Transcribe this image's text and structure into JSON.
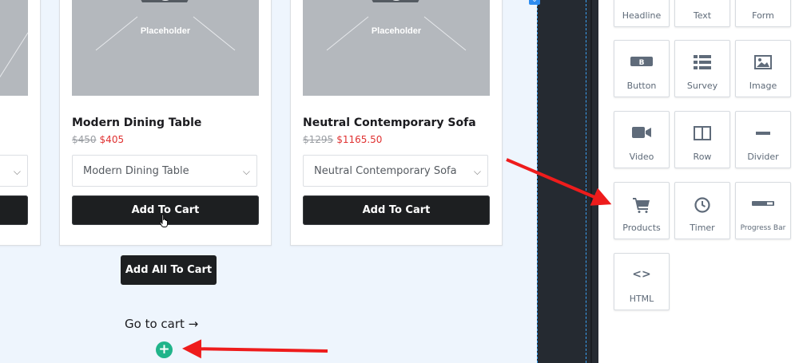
{
  "canvas": {
    "products": [
      {
        "placeholder": "",
        "title": "",
        "price_old": "",
        "price_new": "",
        "select_value": "",
        "button_label": ""
      },
      {
        "placeholder": "Placeholder",
        "title": "Modern Dining Table",
        "price_old": "$450",
        "price_new": "$405",
        "select_value": "Modern Dining Table",
        "button_label": "Add To Cart"
      },
      {
        "placeholder": "Placeholder",
        "title": "Neutral Contemporary Sofa",
        "price_old": "$1295",
        "price_new": "$1165.50",
        "select_value": "Neutral Contemporary Sofa",
        "button_label": "Add To Cart"
      }
    ],
    "add_all_label": "Add All To Cart",
    "go_to_cart_label": "Go to cart →",
    "add_block_symbol": "+"
  },
  "elements_panel": {
    "tiles": [
      {
        "label": "Headline",
        "icon": "headline-icon"
      },
      {
        "label": "Text",
        "icon": "text-icon"
      },
      {
        "label": "Form",
        "icon": "form-icon"
      },
      {
        "label": "Button",
        "icon": "button-icon",
        "glyph": "B"
      },
      {
        "label": "Survey",
        "icon": "survey-icon"
      },
      {
        "label": "Image",
        "icon": "image-icon"
      },
      {
        "label": "Video",
        "icon": "video-icon"
      },
      {
        "label": "Row",
        "icon": "row-icon"
      },
      {
        "label": "Divider",
        "icon": "divider-icon"
      },
      {
        "label": "Products",
        "icon": "cart-icon"
      },
      {
        "label": "Timer",
        "icon": "clock-icon"
      },
      {
        "label": "Progress Bar",
        "icon": "progress-bar-icon"
      },
      {
        "label": "HTML",
        "icon": "code-icon",
        "glyph": "<>"
      }
    ]
  },
  "colors": {
    "canvas_bg": "#eef5fd",
    "button_dark": "#1d1f21",
    "price_sale": "#e03131",
    "add_block_green": "#20b48a",
    "annotation_arrow": "#ee1c1c",
    "guide_blue": "#3aa0f2"
  }
}
